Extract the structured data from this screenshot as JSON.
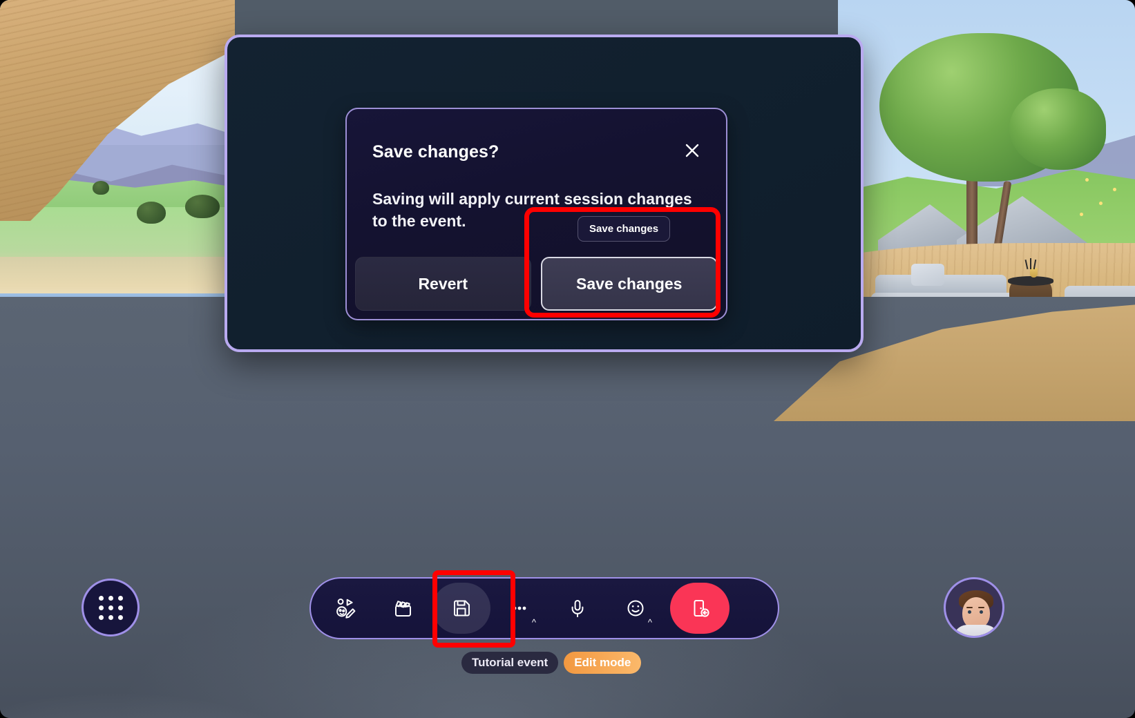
{
  "scene": {
    "description": "Virtual 3D lounge space with outdoor landscape view",
    "floor_color": "#566070",
    "left_window": {
      "elements": "wooden arch, sky, mountains, grass, sand, water"
    },
    "right_area": {
      "elements": "tree, rocks, grass, wooden deck, sofa, coffee table, red ottoman"
    }
  },
  "panel": {
    "border_color": "#b9aaf0",
    "background_color": "#11202e"
  },
  "dialog": {
    "title": "Save changes?",
    "body": "Saving will apply current session changes to the event.",
    "close_label": "Close",
    "border_color": "#9d8fd6",
    "buttons": {
      "revert": "Revert",
      "save": "Save changes"
    }
  },
  "tooltip": {
    "text": "Save changes"
  },
  "highlights": {
    "dialog_save": "Save changes button highlight",
    "toolbar_save": "Save toolbar button highlight",
    "color": "#ff0000"
  },
  "launcher": {
    "label": "Apps",
    "icon": "grid-dots-icon"
  },
  "toolbar": {
    "items": [
      {
        "name": "avatar-edit",
        "icon": "avatar-pencil-icon",
        "label": "Avatar",
        "has_caret": false,
        "active": false
      },
      {
        "name": "clapperboard",
        "icon": "clapperboard-icon",
        "label": "Scenes",
        "has_caret": false,
        "active": false
      },
      {
        "name": "save",
        "icon": "floppy-disk-icon",
        "label": "Save",
        "has_caret": false,
        "active": true
      },
      {
        "name": "more",
        "icon": "ellipsis-icon",
        "label": "More",
        "has_caret": true,
        "active": false
      },
      {
        "name": "microphone",
        "icon": "microphone-icon",
        "label": "Mute",
        "has_caret": false,
        "active": false
      },
      {
        "name": "reactions",
        "icon": "smiley-icon",
        "label": "Reactions",
        "has_caret": true,
        "active": false
      },
      {
        "name": "leave",
        "icon": "door-exit-icon",
        "label": "Leave",
        "has_caret": false,
        "active": false
      }
    ],
    "leave_color": "#fa3556",
    "border_color": "#9f90e8"
  },
  "status_pills": {
    "event_name": "Tutorial event",
    "mode": "Edit mode",
    "mode_color": "#f29840"
  },
  "avatar": {
    "label": "Your avatar"
  }
}
